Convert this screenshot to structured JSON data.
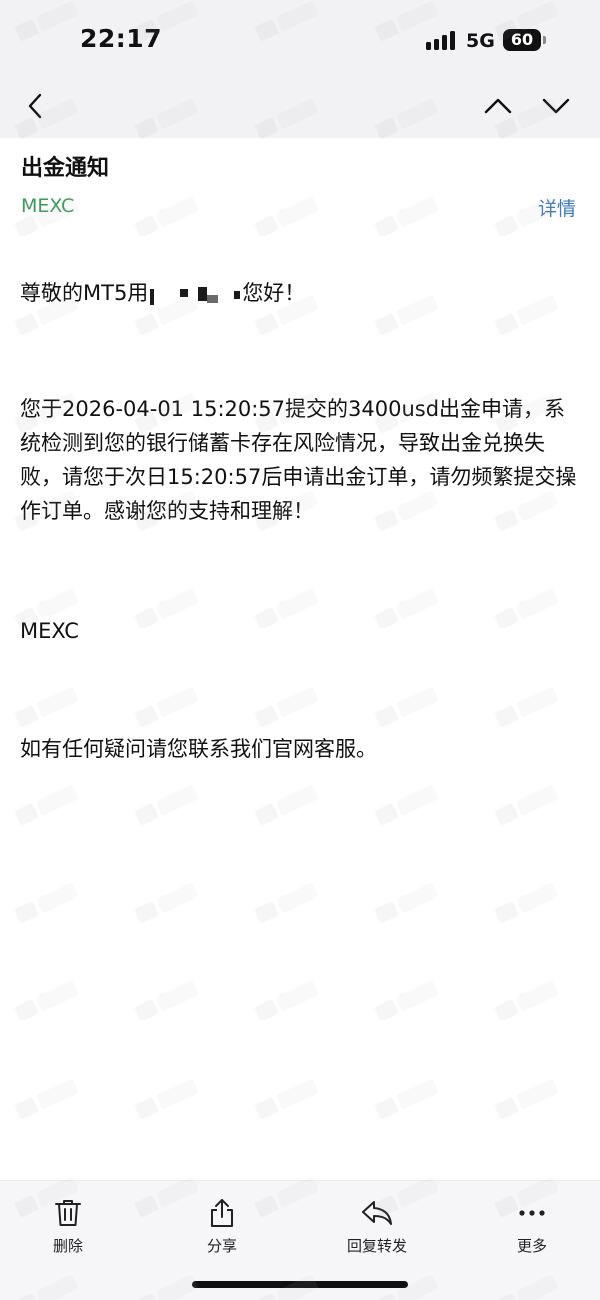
{
  "status_bar": {
    "time": "22:17",
    "network": "5G",
    "battery": "60"
  },
  "nav": {
    "back_icon": "chevron-left-icon",
    "prev_icon": "chevron-up-icon",
    "next_icon": "chevron-down-icon"
  },
  "mail": {
    "subject": "出金通知",
    "sender": "MEXC",
    "details_label": "详情",
    "greeting_prefix": "尊敬的MT5用",
    "greeting_suffix": "您好！",
    "paragraph": "您于2026-04-01 15:20:57提交的3400usd出金申请，系统检测到您的银行储蓄卡存在风险情况，导致出金兑换失败，请您于次日15:20:57后申请出金订单，请勿频繁提交操作订单。感谢您的支持和理解！",
    "signature": "MEXC",
    "contact": "如有任何疑问请您联系我们官网客服。"
  },
  "toolbar": {
    "delete_label": "删除",
    "share_label": "分享",
    "reply_forward_label": "回复转发",
    "more_label": "更多"
  },
  "colors": {
    "sender": "#3a9a5a",
    "link": "#3d79b8",
    "top_bg": "#f2f2f4",
    "toolbar_bg": "#f6f6f8"
  }
}
